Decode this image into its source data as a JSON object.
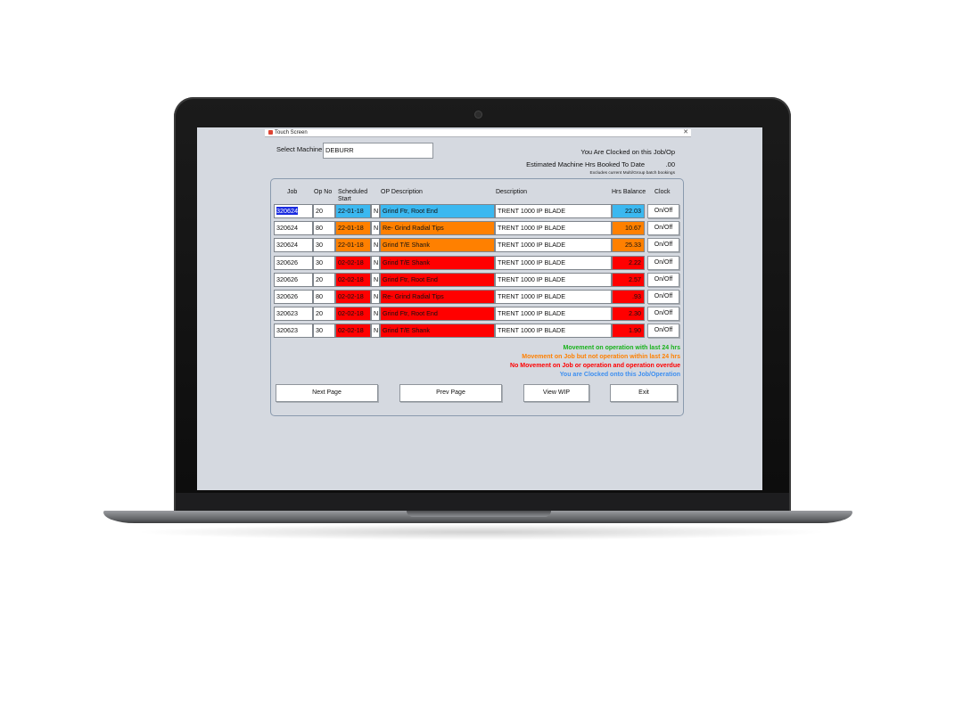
{
  "window": {
    "title": "Touch Screen",
    "close_glyph": "✕"
  },
  "colors": {
    "clocked": "#3bb8f0",
    "movement_job": "#ff8000",
    "overdue": "#ff0000",
    "selection": "#1a2ce0"
  },
  "machine": {
    "label": "Select Machine",
    "value": "DEBURR"
  },
  "status": {
    "clocked_on": "You Are Clocked on this Job/Op",
    "est_hours_label": "Estimated Machine Hrs Booked To Date",
    "est_hours_value": ".00",
    "note": "Excludes current Multi/Group batch bookings"
  },
  "table": {
    "headers": {
      "job": "Job",
      "op_no": "Op No",
      "scheduled_start": "Scheduled Start",
      "op_description": "OP Description",
      "description": "Description",
      "hrs_balance": "Hrs Balance",
      "clock": "Clock"
    },
    "rows": [
      {
        "job": "320624",
        "op_no": "20",
        "date": "22-01-18",
        "flag": "N",
        "op_desc": "Grind Ftr, Root End",
        "desc": "TRENT 1000 IP BLADE",
        "hrs": "22.03",
        "clock": "On/Off",
        "status": "clocked",
        "selected": true
      },
      {
        "job": "320624",
        "op_no": "80",
        "date": "22-01-18",
        "flag": "N",
        "op_desc": "Re- Grind Radial Tips",
        "desc": "TRENT 1000 IP BLADE",
        "hrs": "10.67",
        "clock": "On/Off",
        "status": "movement_job"
      },
      {
        "job": "320624",
        "op_no": "30",
        "date": "22-01-18",
        "flag": "N",
        "op_desc": "Grind T/E Shank",
        "desc": "TRENT 1000 IP BLADE",
        "hrs": "25.33",
        "clock": "On/Off",
        "status": "movement_job"
      },
      {
        "job": "320626",
        "op_no": "30",
        "date": "02-02-18",
        "flag": "N",
        "op_desc": "Grind T/E Shank",
        "desc": "TRENT 1000 IP BLADE",
        "hrs": "2.22",
        "clock": "On/Off",
        "status": "overdue"
      },
      {
        "job": "320626",
        "op_no": "20",
        "date": "02-02-18",
        "flag": "N",
        "op_desc": "Grind Ftr, Root End",
        "desc": "TRENT 1000 IP BLADE",
        "hrs": "2.57",
        "clock": "On/Off",
        "status": "overdue"
      },
      {
        "job": "320626",
        "op_no": "80",
        "date": "02-02-18",
        "flag": "N",
        "op_desc": "Re- Grind Radial Tips",
        "desc": "TRENT 1000 IP BLADE",
        "hrs": ".93",
        "clock": "On/Off",
        "status": "overdue"
      },
      {
        "job": "320623",
        "op_no": "20",
        "date": "02-02-18",
        "flag": "N",
        "op_desc": "Grind Ftr, Root End",
        "desc": "TRENT 1000 IP BLADE",
        "hrs": "2.30",
        "clock": "On/Off",
        "status": "overdue"
      },
      {
        "job": "320623",
        "op_no": "30",
        "date": "02-02-18",
        "flag": "N",
        "op_desc": "Grind T/E Shank",
        "desc": "TRENT 1000 IP BLADE",
        "hrs": "1.90",
        "clock": "On/Off",
        "status": "overdue"
      }
    ]
  },
  "legend": {
    "green": {
      "text": "Movement on operation with last 24 hrs",
      "color": "#18b21a"
    },
    "orange": {
      "text": "Movement on Job but not operation within last 24 hrs",
      "color": "#ff8000"
    },
    "red": {
      "text": "No Movement on Job or operation and operation overdue",
      "color": "#ff0000"
    },
    "blue": {
      "text": "You are Clocked onto this Job/Operation",
      "color": "#3d8ff0"
    }
  },
  "buttons": {
    "next_page": "Next Page",
    "prev_page": "Prev Page",
    "view_wip": "View WIP",
    "exit": "Exit"
  }
}
